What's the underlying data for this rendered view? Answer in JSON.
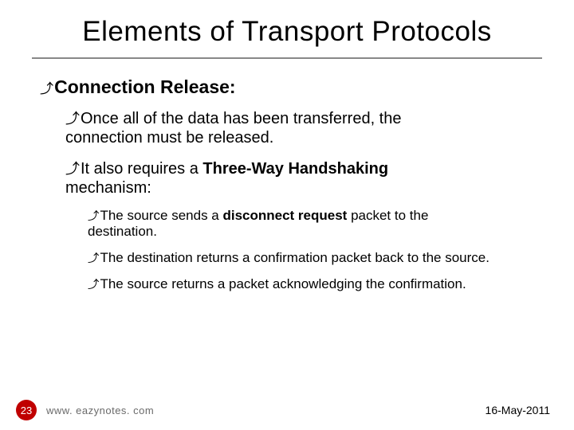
{
  "title": "Elements of Transport Protocols",
  "section": {
    "heading": "Connection Release:"
  },
  "points": {
    "p1a": "Once all of the data has been transferred, the",
    "p1b": "connection must be released.",
    "p2a": "It also requires a ",
    "p2bold": "Three-Way Handshaking",
    "p2b": "mechanism:",
    "s1a": "The source sends a ",
    "s1bold": "disconnect request",
    "s1b": " packet to the",
    "s1c": "destination.",
    "s2": "The destination returns a confirmation packet back to the source.",
    "s3": "The source returns a packet acknowledging the confirmation."
  },
  "footer": {
    "page": "23",
    "site": "www. eazynotes. com",
    "date": "16-May-2011"
  },
  "glyphs": {
    "bullet": "⤴"
  }
}
